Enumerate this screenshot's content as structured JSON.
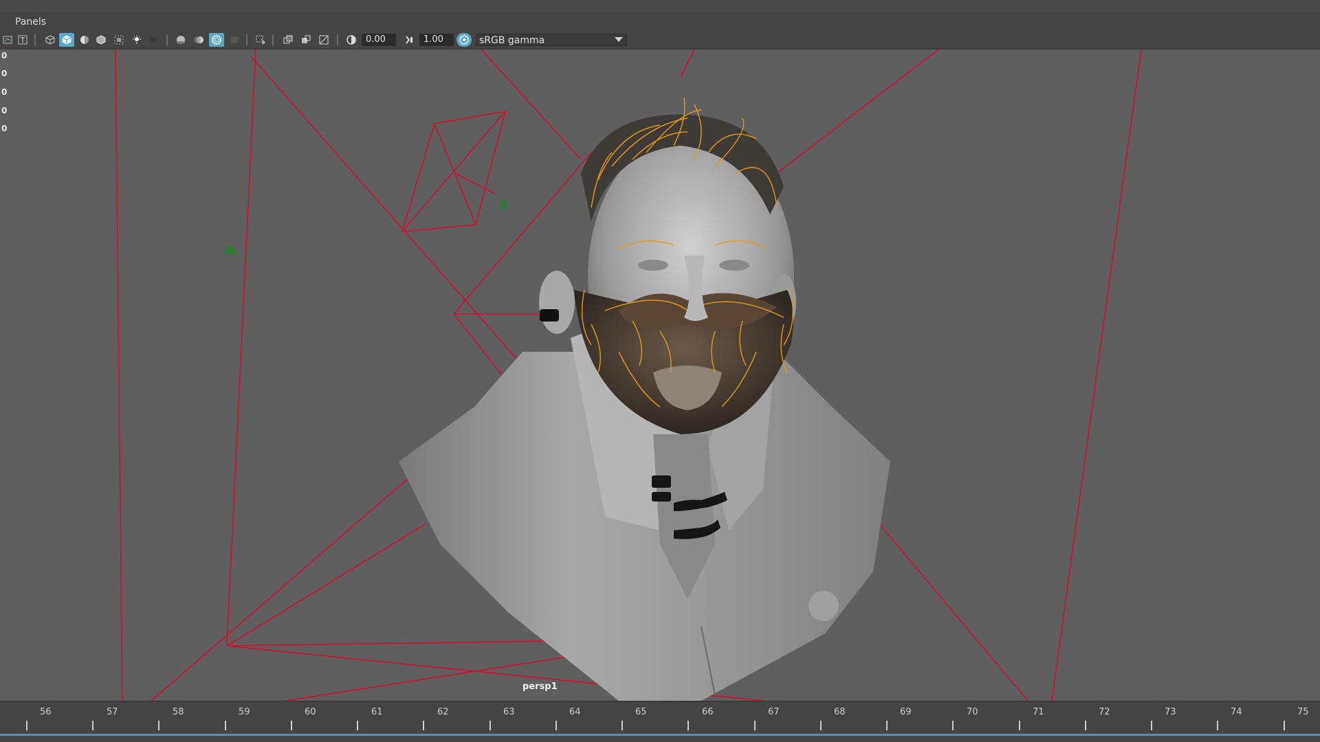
{
  "menubar": {
    "panels_label": "Panels"
  },
  "toolbar": {
    "exposure_value": "0.00",
    "gamma_value": "1.00",
    "color_space": "sRGB gamma"
  },
  "hud": {
    "left_values": [
      "0",
      "0",
      "0",
      "0",
      "0"
    ]
  },
  "viewport": {
    "camera_label": "persp1"
  },
  "timeline": {
    "frames": [
      "56",
      "57",
      "58",
      "59",
      "60",
      "61",
      "62",
      "63",
      "64",
      "65",
      "66",
      "67",
      "68",
      "69",
      "70",
      "71",
      "72",
      "73",
      "74",
      "75"
    ]
  },
  "colors": {
    "accent_active": "#5aa7c6",
    "wire_red": "#c8102e",
    "hair_orange": "#e39a1a",
    "viewport_bg": "#5f5f5f"
  }
}
